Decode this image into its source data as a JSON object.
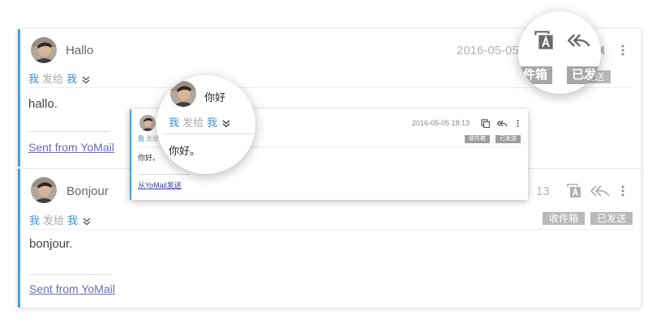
{
  "messages": [
    {
      "sender": "Hallo",
      "date": "2016-05-05",
      "recipients": {
        "me": "我",
        "sent_to": "发给",
        "target": "我"
      },
      "body": "hallo.",
      "signature": "Sent from YoMail",
      "tags": [
        "收件箱",
        "已发送"
      ]
    },
    {
      "sender": "Bonjour",
      "date": "13",
      "recipients": {
        "me": "我",
        "sent_to": "发给",
        "target": "我"
      },
      "body": "bonjour.",
      "signature": "Sent from YoMail",
      "tags": [
        "收件箱",
        "已发送"
      ]
    }
  ],
  "mini": {
    "sender_cut": "我",
    "sent_to_cut": "发给",
    "date": "2016-05-05 18:13",
    "tags": [
      "收件箱",
      "已发送"
    ],
    "body": "你好。",
    "signature": "从YoMail发送"
  },
  "lens_left": {
    "sender": "你好",
    "recipients": {
      "me": "我",
      "sent_to": "发给",
      "target": "我"
    },
    "body": "你好。"
  },
  "lens_right": {
    "tag_left": "件箱",
    "tag_right": "已发送"
  },
  "colors": {
    "accent": "#4a9fd8",
    "tag_bg": "#b9b9b9",
    "link": "#6a6ab8"
  }
}
